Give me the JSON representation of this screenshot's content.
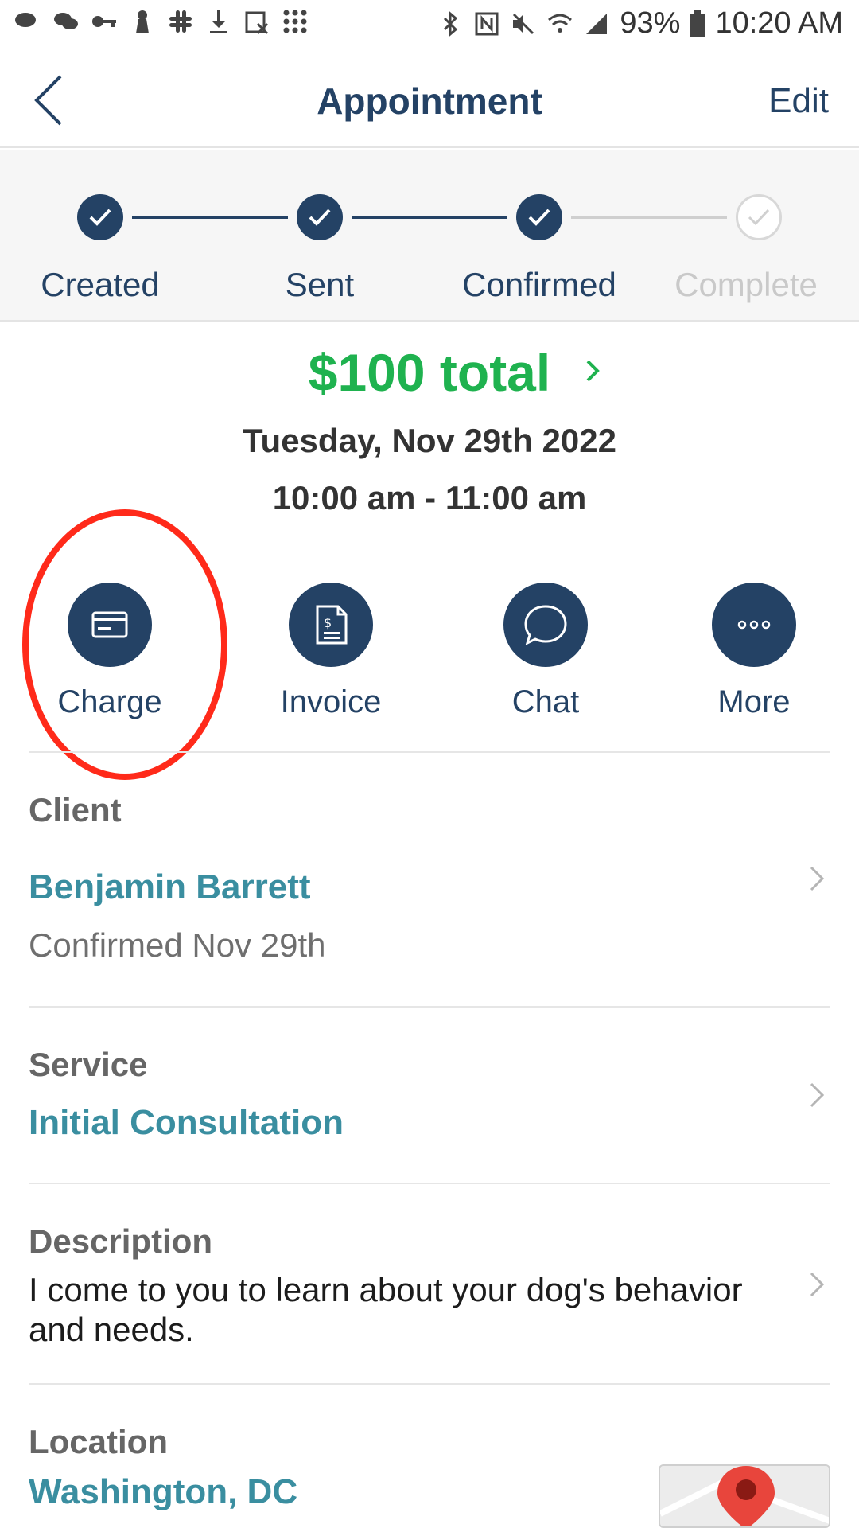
{
  "statusbar": {
    "battery_pct": "93%",
    "time": "10:20 AM"
  },
  "header": {
    "title": "Appointment",
    "edit_label": "Edit"
  },
  "progress": {
    "steps": [
      {
        "label": "Created",
        "done": true
      },
      {
        "label": "Sent",
        "done": true
      },
      {
        "label": "Confirmed",
        "done": true
      },
      {
        "label": "Complete",
        "done": false
      }
    ]
  },
  "summary": {
    "total": "$100 total",
    "date": "Tuesday, Nov 29th 2022",
    "time_range": "10:00 am - 11:00 am"
  },
  "actions": [
    {
      "label": "Charge",
      "icon": "card-icon"
    },
    {
      "label": "Invoice",
      "icon": "invoice-icon"
    },
    {
      "label": "Chat",
      "icon": "chat-icon"
    },
    {
      "label": "More",
      "icon": "more-icon"
    }
  ],
  "client": {
    "label": "Client",
    "name": "Benjamin Barrett",
    "status": "Confirmed Nov 29th"
  },
  "service": {
    "label": "Service",
    "name": "Initial Consultation"
  },
  "description": {
    "label": "Description",
    "text": "I come to you to learn about your dog's behavior and needs."
  },
  "location": {
    "label": "Location",
    "value": "Washington, DC"
  },
  "colors": {
    "brand_navy": "#244265",
    "total_green": "#1fb24f",
    "link_teal": "#3a8ea0",
    "highlight_red": "#ff2a1a"
  }
}
